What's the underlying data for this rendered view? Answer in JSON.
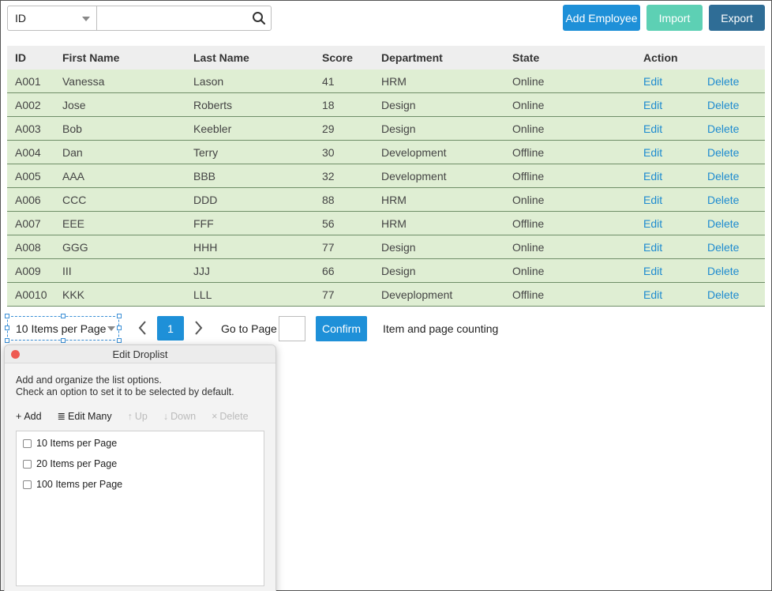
{
  "search": {
    "field_selected": "ID",
    "query": ""
  },
  "toolbar": {
    "add_label": "Add Employee",
    "import_label": "Import",
    "export_label": "Export"
  },
  "table": {
    "headers": {
      "id": "ID",
      "first": "First Name",
      "last": "Last Name",
      "score": "Score",
      "dept": "Department",
      "state": "State",
      "action": "Action"
    },
    "rows": [
      {
        "id": "A001",
        "first": "Vanessa",
        "last": "Lason",
        "score": "41",
        "dept": "HRM",
        "state": "Online",
        "edit": "Edit",
        "delete": "Delete"
      },
      {
        "id": "A002",
        "first": "Jose",
        "last": "Roberts",
        "score": "18",
        "dept": "Design",
        "state": "Online",
        "edit": "Edit",
        "delete": "Delete"
      },
      {
        "id": "A003",
        "first": "Bob",
        "last": "Keebler",
        "score": "29",
        "dept": "Design",
        "state": "Online",
        "edit": "Edit",
        "delete": "Delete"
      },
      {
        "id": "A004",
        "first": "Dan",
        "last": "Terry",
        "score": "30",
        "dept": "Development",
        "state": "Offline",
        "edit": "Edit",
        "delete": "Delete"
      },
      {
        "id": "A005",
        "first": "AAA",
        "last": "BBB",
        "score": "32",
        "dept": "Development",
        "state": "Offline",
        "edit": "Edit",
        "delete": "Delete"
      },
      {
        "id": "A006",
        "first": "CCC",
        "last": "DDD",
        "score": "88",
        "dept": "HRM",
        "state": "Online",
        "edit": "Edit",
        "delete": "Delete"
      },
      {
        "id": "A007",
        "first": "EEE",
        "last": "FFF",
        "score": "56",
        "dept": "HRM",
        "state": "Offline",
        "edit": "Edit",
        "delete": "Delete"
      },
      {
        "id": "A008",
        "first": "GGG",
        "last": "HHH",
        "score": "77",
        "dept": "Design",
        "state": "Online",
        "edit": "Edit",
        "delete": "Delete"
      },
      {
        "id": "A009",
        "first": "III",
        "last": "JJJ",
        "score": "66",
        "dept": "Design",
        "state": "Online",
        "edit": "Edit",
        "delete": "Delete"
      },
      {
        "id": "A0010",
        "first": "KKK",
        "last": "LLL",
        "score": "77",
        "dept": "Deveplopment",
        "state": "Offline",
        "edit": "Edit",
        "delete": "Delete"
      }
    ]
  },
  "pagination": {
    "per_page_selected": "10 Items per Page",
    "current_page": "1",
    "goto_label": "Go to Page",
    "goto_value": "",
    "confirm_label": "Confirm",
    "counting_label": "Item and page counting"
  },
  "dialog": {
    "title": "Edit Droplist",
    "desc_line1": "Add and organize the list options.",
    "desc_line2": "Check an option to set it to be selected by default.",
    "tools": {
      "add": "Add",
      "edit_many": "Edit Many",
      "up": "Up",
      "down": "Down",
      "delete": "Delete"
    },
    "options": [
      {
        "label": "10 Items per Page",
        "checked": false
      },
      {
        "label": "20 Items per Page",
        "checked": false
      },
      {
        "label": "100 Items per Page",
        "checked": false
      }
    ]
  },
  "colors": {
    "primary": "#1e90d8",
    "import": "#5dd0b4",
    "export": "#2f6d96",
    "row_bg": "#dfeed3",
    "link": "#1e8bd0"
  }
}
